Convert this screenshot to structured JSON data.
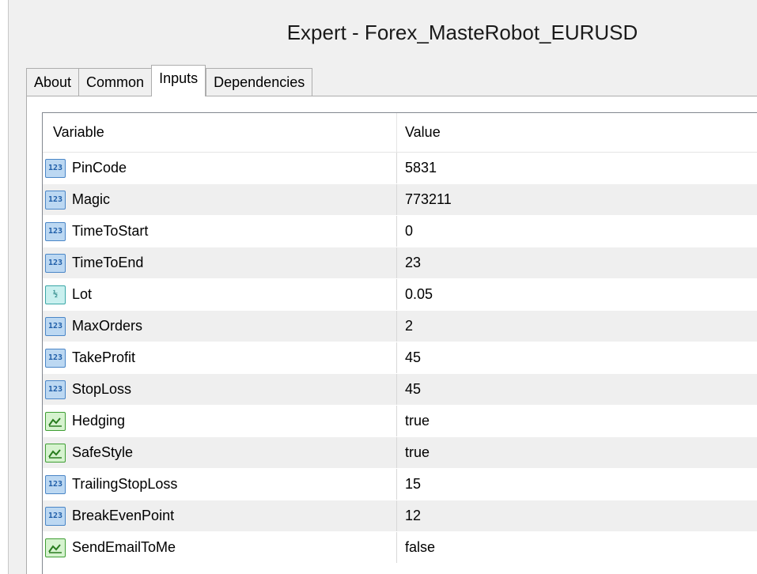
{
  "window": {
    "title": "Expert - Forex_MasteRobot_EURUSD"
  },
  "tabs": [
    {
      "label": "About",
      "active": false
    },
    {
      "label": "Common",
      "active": false
    },
    {
      "label": "Inputs",
      "active": true
    },
    {
      "label": "Dependencies",
      "active": false
    }
  ],
  "table": {
    "headers": {
      "variable": "Variable",
      "value": "Value"
    },
    "rows": [
      {
        "icon": "int-type-icon",
        "icon_text": "123",
        "variable": "PinCode",
        "value": "5831"
      },
      {
        "icon": "int-type-icon",
        "icon_text": "123",
        "variable": "Magic",
        "value": "773211"
      },
      {
        "icon": "int-type-icon",
        "icon_text": "123",
        "variable": "TimeToStart",
        "value": "0"
      },
      {
        "icon": "int-type-icon",
        "icon_text": "123",
        "variable": "TimeToEnd",
        "value": "23"
      },
      {
        "icon": "double-type-icon",
        "icon_text": "½",
        "variable": "Lot",
        "value": "0.05"
      },
      {
        "icon": "int-type-icon",
        "icon_text": "123",
        "variable": "MaxOrders",
        "value": "2"
      },
      {
        "icon": "int-type-icon",
        "icon_text": "123",
        "variable": "TakeProfit",
        "value": "45"
      },
      {
        "icon": "int-type-icon",
        "icon_text": "123",
        "variable": "StopLoss",
        "value": "45"
      },
      {
        "icon": "bool-type-icon",
        "icon_text": "",
        "variable": "Hedging",
        "value": "true"
      },
      {
        "icon": "bool-type-icon",
        "icon_text": "",
        "variable": "SafeStyle",
        "value": "true"
      },
      {
        "icon": "int-type-icon",
        "icon_text": "123",
        "variable": "TrailingStopLoss",
        "value": "15"
      },
      {
        "icon": "int-type-icon",
        "icon_text": "123",
        "variable": "BreakEvenPoint",
        "value": "12"
      },
      {
        "icon": "bool-type-icon",
        "icon_text": "",
        "variable": "SendEmailToMe",
        "value": "false"
      }
    ]
  },
  "colors": {
    "row_alt": "#efefef",
    "int_icon": "#bcd8f2",
    "double_icon": "#c9f0ef",
    "bool_icon": "#d6f3cf"
  }
}
